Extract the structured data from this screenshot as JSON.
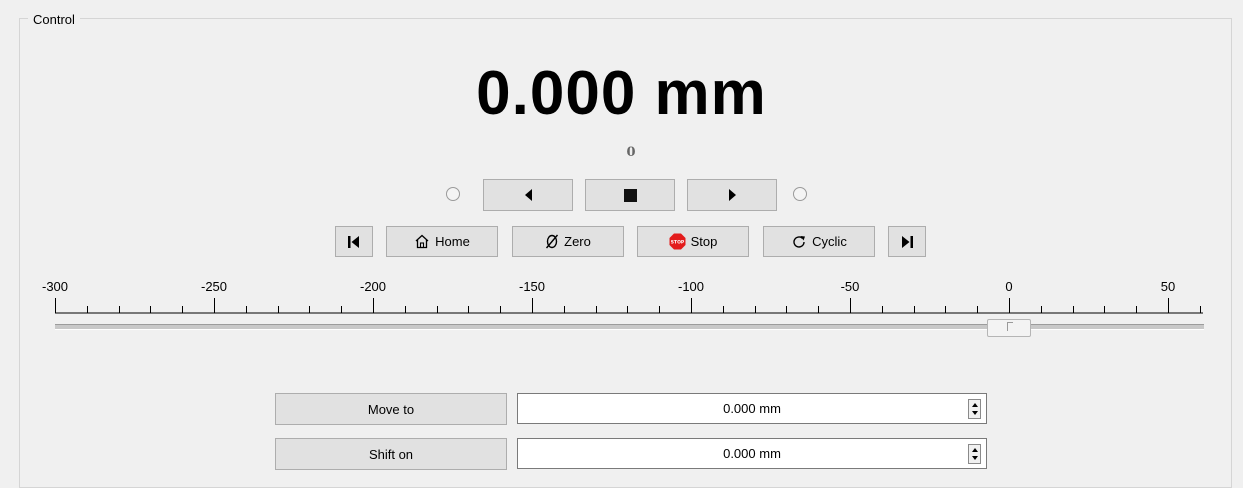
{
  "group": {
    "title": "Control"
  },
  "position": {
    "value": "0.000 mm"
  },
  "step_count": "0",
  "jog": {
    "left_icon": "triangle-left-icon",
    "stop_icon": "square-stop-icon",
    "right_icon": "triangle-right-icon"
  },
  "toolbar": {
    "home_label": "Home",
    "zero_label": "Zero",
    "stop_label": "Stop",
    "cyclic_label": "Cyclic",
    "stop_icon_text": "STOP"
  },
  "ruler": {
    "labels": [
      "-300",
      "-250",
      "-200",
      "-150",
      "-100",
      "-50",
      "0",
      "50"
    ],
    "min": -300,
    "max": 60,
    "major_step": 50,
    "minor_step": 10
  },
  "slider": {
    "value": 0
  },
  "move_to": {
    "label": "Move to",
    "value": "0.000 mm"
  },
  "shift_on": {
    "label": "Shift on",
    "value": "0.000 mm"
  },
  "colors": {
    "stop_red": "#e31c1c",
    "button_bg": "#e1e1e1",
    "window_bg": "#f0f0f0"
  }
}
